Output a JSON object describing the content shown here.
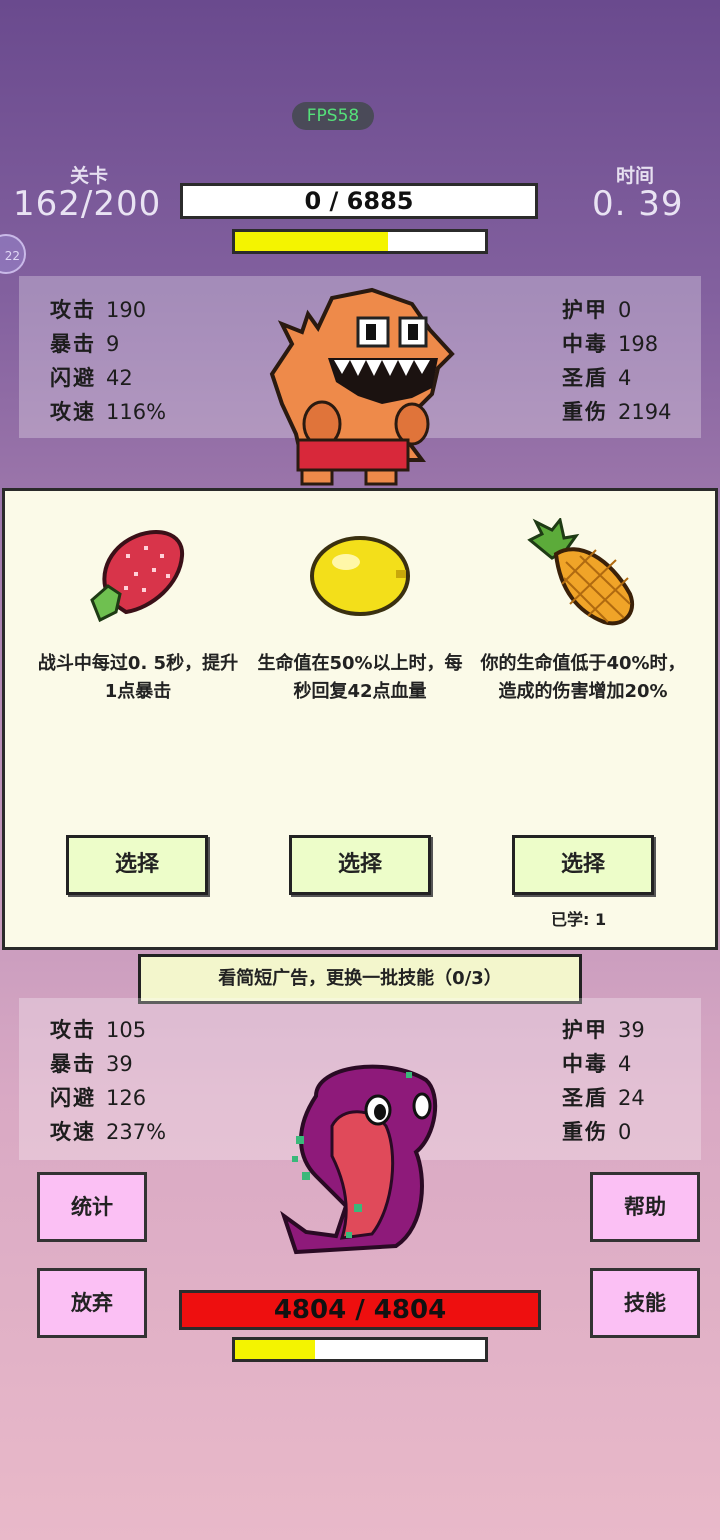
{
  "fps": "FPS58",
  "header": {
    "level_label": "关卡",
    "level_value": "162/200",
    "time_label": "时间",
    "time_value": "0. 39",
    "enemy_hp_text": "0  /  6885",
    "enemy_bar_fill": 0.61,
    "side_badge": "22"
  },
  "enemy_stats": {
    "left": [
      {
        "k": "攻击",
        "v": "190"
      },
      {
        "k": "暴击",
        "v": "9"
      },
      {
        "k": "闪避",
        "v": "42"
      },
      {
        "k": "攻速",
        "v": "116%"
      }
    ],
    "right": [
      {
        "k": "护甲",
        "v": "0"
      },
      {
        "k": "中毒",
        "v": "198"
      },
      {
        "k": "圣盾",
        "v": "4"
      },
      {
        "k": "重伤",
        "v": "2194"
      }
    ],
    "sprite": "orange-monster-icon"
  },
  "skills": [
    {
      "icon": "strawberry-icon",
      "desc": "战斗中每过0. 5秒，提升1点暴击",
      "button": "选择",
      "learned": ""
    },
    {
      "icon": "lemon-icon",
      "desc": "生命值在50%以上时，每秒回复42点血量",
      "button": "选择",
      "learned": ""
    },
    {
      "icon": "pineapple-icon",
      "desc": "你的生命值低于40%时，造成的伤害增加20%",
      "button": "选择",
      "learned": "已学: 1"
    }
  ],
  "ad_banner": "看简短广告，更换一批技能（0/3）",
  "player_stats": {
    "left": [
      {
        "k": "攻击",
        "v": "105"
      },
      {
        "k": "暴击",
        "v": "39"
      },
      {
        "k": "闪避",
        "v": "126"
      },
      {
        "k": "攻速",
        "v": "237%"
      }
    ],
    "right": [
      {
        "k": "护甲",
        "v": "39"
      },
      {
        "k": "中毒",
        "v": "4"
      },
      {
        "k": "圣盾",
        "v": "24"
      },
      {
        "k": "重伤",
        "v": "0"
      }
    ],
    "sprite": "cobra-icon"
  },
  "buttons": {
    "stats": "统计",
    "help": "帮助",
    "give_up": "放弃",
    "skills": "技能"
  },
  "player_hp_text": "4804  /  4804",
  "player_bar_fill": 0.32,
  "colors": {
    "hp_bar": "#ee0f0f",
    "progress_fill": "#f4f400",
    "card_bg": "#fbfae8",
    "select_button": "#edfdc9",
    "menu_button": "#fbc0f4"
  }
}
